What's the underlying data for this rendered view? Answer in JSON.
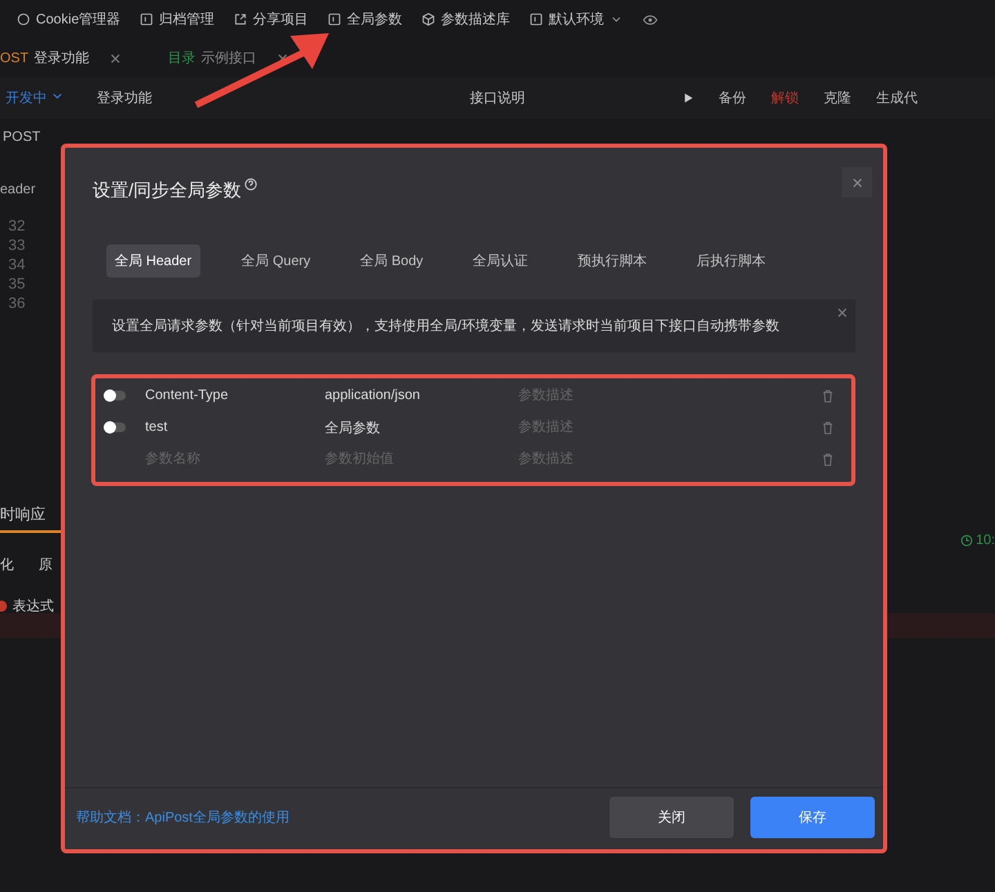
{
  "toolbar": [
    {
      "label": "Cookie管理器"
    },
    {
      "label": "归档管理"
    },
    {
      "label": "分享项目"
    },
    {
      "label": "全局参数"
    },
    {
      "label": "参数描述库"
    },
    {
      "label": "默认环境"
    }
  ],
  "tabs": [
    {
      "method": "OST",
      "label": "登录功能",
      "kind": "request",
      "selected": true
    },
    {
      "method": "目录",
      "label": "示例接口",
      "kind": "folder",
      "selected": false
    }
  ],
  "request_bar": {
    "status": "开发中",
    "name": "登录功能",
    "description": "接口说明",
    "actions": [
      {
        "label": "备份",
        "kind": "normal"
      },
      {
        "label": "解锁",
        "kind": "danger"
      },
      {
        "label": "克隆",
        "kind": "normal"
      },
      {
        "label": "生成代",
        "kind": "normal"
      }
    ]
  },
  "sidebar": {
    "method": "POST",
    "tab": "eader",
    "line_numbers": [
      "32",
      "33",
      "34",
      "35",
      "36"
    ],
    "response_tab": "时响应",
    "view_tabs": [
      "化",
      "原"
    ],
    "error": "表达式"
  },
  "time": "10:",
  "dialog": {
    "title": "设置/同步全局参数",
    "tabs": [
      {
        "label": "全局 Header",
        "selected": true
      },
      {
        "label": "全局 Query",
        "selected": false
      },
      {
        "label": "全局 Body",
        "selected": false
      },
      {
        "label": "全局认证",
        "selected": false
      },
      {
        "label": "预执行脚本",
        "selected": false
      },
      {
        "label": "后执行脚本",
        "selected": false
      }
    ],
    "notice": "设置全局请求参数（针对当前项目有效），支持使用全局/环境变量，发送请求时当前项目下接口自动携带参数",
    "rows": [
      {
        "on": false,
        "name": "Content-Type",
        "value": "application/json",
        "description": {
          "placeholder": "参数描述"
        }
      },
      {
        "on": false,
        "name": "test",
        "value": "全局参数",
        "description": {
          "placeholder": "参数描述"
        }
      }
    ],
    "new_row": {
      "name_placeholder": "参数名称",
      "value_placeholder": "参数初始值",
      "description_placeholder": "参数描述"
    },
    "help_link": "帮助文档：ApiPost全局参数的使用",
    "buttons": [
      {
        "label": "关闭",
        "kind": "secondary"
      },
      {
        "label": "保存",
        "kind": "primary"
      }
    ]
  }
}
